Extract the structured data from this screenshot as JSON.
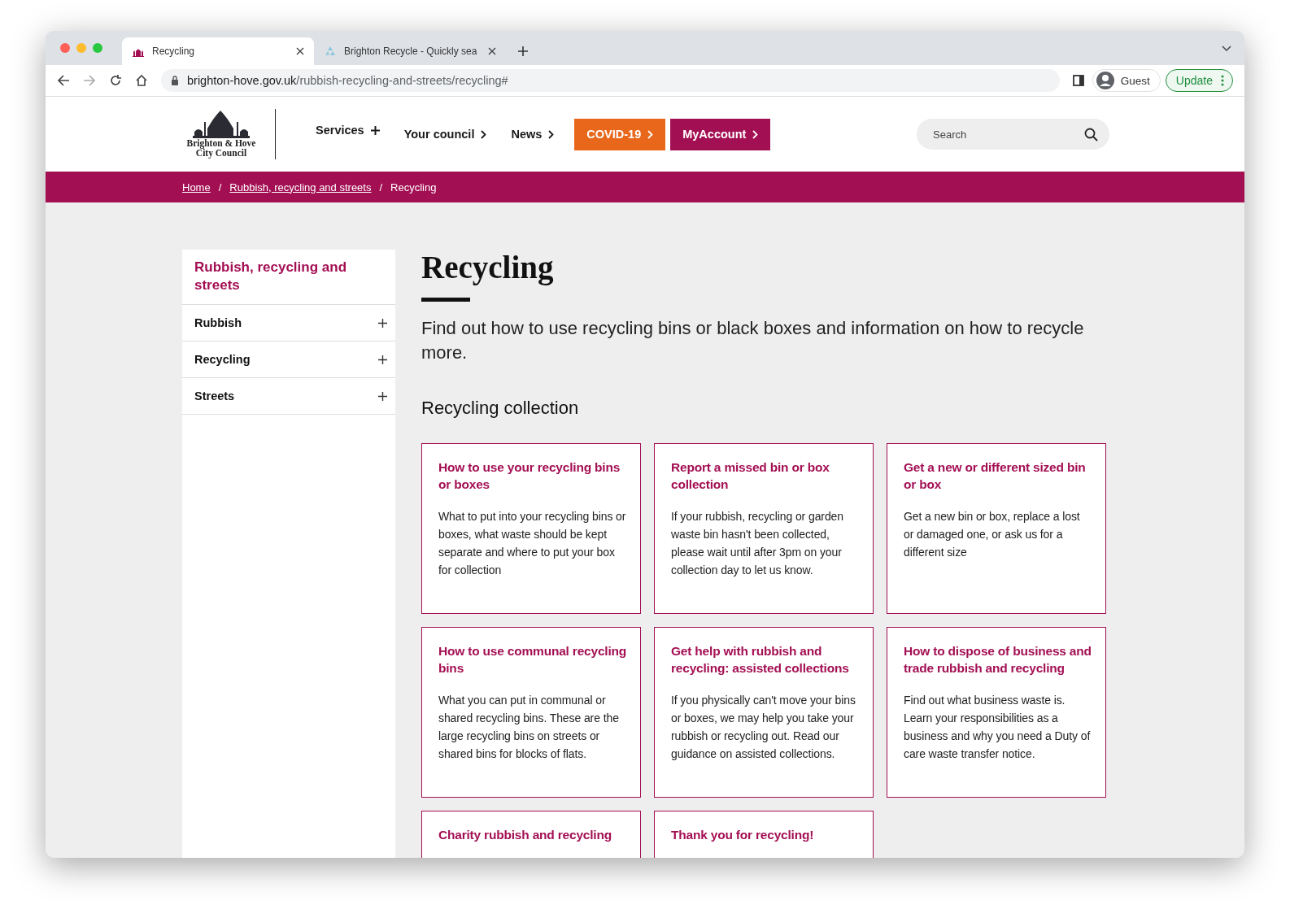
{
  "browser": {
    "tabs": [
      {
        "title": "Recycling",
        "selected": true
      },
      {
        "title": "Brighton Recycle - Quickly sea",
        "selected": false
      }
    ],
    "url_host": "brighton-hove.gov.uk",
    "url_path": "/rubbish-recycling-and-streets/recycling#",
    "profile": "Guest",
    "update_button": "Update"
  },
  "header": {
    "logo_lines": [
      "Brighton & Hove",
      "City Council"
    ],
    "nav": [
      {
        "label": "Services",
        "kind": "plus"
      },
      {
        "label": "Your council",
        "kind": "chevron"
      },
      {
        "label": "News",
        "kind": "chevron"
      },
      {
        "label": "COVID-19",
        "kind": "covid"
      },
      {
        "label": "MyAccount",
        "kind": "account"
      }
    ],
    "search": {
      "placeholder": "Search"
    }
  },
  "breadcrumb": [
    {
      "label": "Home",
      "link": true
    },
    {
      "separator": "/",
      "label": "Rubbish, recycling and streets",
      "link": true
    },
    {
      "separator": "/",
      "label": "Recycling",
      "link": false
    }
  ],
  "sidebar": {
    "title": "Rubbish, recycling and streets",
    "items": [
      {
        "label": "Rubbish",
        "expanded": false
      },
      {
        "label": "Recycling",
        "expanded": false
      },
      {
        "label": "Streets",
        "expanded": false
      }
    ]
  },
  "main": {
    "title": "Recycling",
    "intro": "Find out how to use recycling bins or black boxes and information on how to recycle more.",
    "section": "Recycling collection",
    "cards": [
      {
        "title": "How to use your recycling bins or boxes",
        "text": "What to put into your recycling bins or boxes, what waste should be kept separate and where to put your box for collection"
      },
      {
        "title": "Report a missed bin or box collection",
        "text": "If your rubbish, recycling or garden waste bin hasn't been collected, please wait until after 3pm on your collection day to let us know."
      },
      {
        "title": "Get a new or different sized bin or box",
        "text": "Get a new bin or box, replace a lost or damaged one, or ask us for a different size"
      },
      {
        "title": "How to use communal recycling bins",
        "text": "What you can put in communal or shared recycling bins. These are the large recycling bins on streets or shared bins for blocks of flats."
      },
      {
        "title": "Get help with rubbish and recycling: assisted collections",
        "text": "If you physically can't move your bins or boxes, we may help you take your rubbish or recycling out. Read our guidance on assisted collections."
      },
      {
        "title": "How to dispose of business and trade rubbish and recycling",
        "text": "Find out what business waste is. Learn your responsibilities as a business and why you need a Duty of care waste transfer notice."
      },
      {
        "title": "Charity rubbish and recycling"
      },
      {
        "title": "Thank you for recycling!"
      }
    ]
  }
}
